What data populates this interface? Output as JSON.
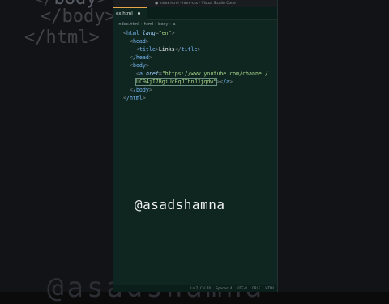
{
  "background": {
    "lines": [
      "</body>",
      "</html>"
    ],
    "watermark": "@asadshamna"
  },
  "window": {
    "title": "● index.html - html-css - Visual Studio Code"
  },
  "tab": {
    "label": "ex.html"
  },
  "breadcrumb": [
    "index.html",
    "html",
    "body",
    "a"
  ],
  "code_lines": {
    "l1_tag": "html",
    "l1_attr": "lang",
    "l1_val": "\"en\"",
    "l2_tag": "head",
    "l3_open": "title",
    "l3_text": "Links",
    "l3_close": "title",
    "l4_tag": "/head",
    "l5_tag": "body",
    "l6_tag": "a",
    "l6_attr": "href",
    "l6_val1": "\"https://www.youtube.com/channel/",
    "l7_val2": "UC94jI7BgiUcEqJTbnJJjqdw\"",
    "l7_close": "/a",
    "l8_tag": "/body",
    "l9_tag": "/html"
  },
  "overlay": {
    "handle": "@asadshamna"
  },
  "status": {
    "left": "Ln 7, Col 70   Spaces: 4   UTF-8   CRLF   HTML",
    "right_a": "Ln 7, Col 70",
    "right_b": "Spaces: 4",
    "right_c": "UTF-8",
    "right_d": "CRLF",
    "right_e": "HTML"
  },
  "colors": {
    "editor_bg": "#0f2620",
    "tag": "#79b8f5",
    "string": "#a8d48a",
    "attr": "#a6d1ff"
  }
}
